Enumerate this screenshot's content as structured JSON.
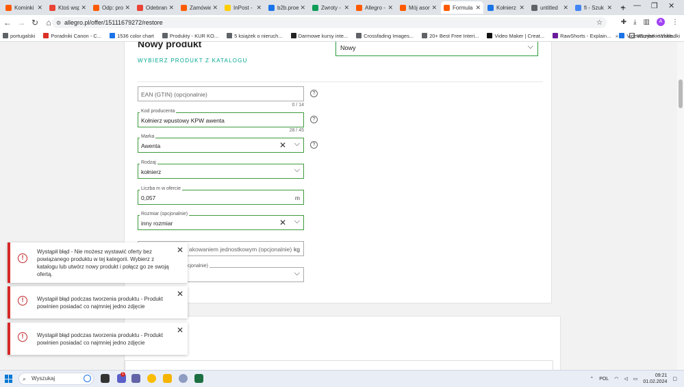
{
  "browser": {
    "tabs": [
      {
        "label": "Kominki",
        "color": "#ff5a00"
      },
      {
        "label": "Ktoś wsp",
        "color": "#ea4335"
      },
      {
        "label": "Odp: pro",
        "color": "#ff5a00"
      },
      {
        "label": "Odebrane",
        "color": "#ea4335"
      },
      {
        "label": "Zamówie",
        "color": "#ff5a00"
      },
      {
        "label": "InPost - ",
        "color": "#ffcd00"
      },
      {
        "label": "b2b.proe",
        "color": "#1a73e8"
      },
      {
        "label": "Zwroty - ",
        "color": "#0f9d58"
      },
      {
        "label": "Allegro - ",
        "color": "#ff5a00"
      },
      {
        "label": "Mój asor",
        "color": "#ff5a00"
      },
      {
        "label": "Formula",
        "color": "#ff5a00"
      },
      {
        "label": "Kołnierz",
        "color": "#1a73e8"
      },
      {
        "label": "untitled",
        "color": "#5f6368"
      },
      {
        "label": "fi - Szuk",
        "color": "#4285f4"
      }
    ],
    "active_tab_index": 10,
    "url": "allegro.pl/offer/15111679272/restore",
    "profile_initial": "A",
    "bookmarks": [
      {
        "label": "portugalski",
        "color": "#5f6368"
      },
      {
        "label": "Poradniki Canon - C...",
        "color": "#d93025"
      },
      {
        "label": "1536 color chart",
        "color": "#1a73e8"
      },
      {
        "label": "Produkty - KUR KO...",
        "color": "#5f6368"
      },
      {
        "label": "5 książek o nieruch...",
        "color": "#5f6368"
      },
      {
        "label": "Darmowe kursy inte...",
        "color": "#222222"
      },
      {
        "label": "Crossfading Images...",
        "color": "#5f6368"
      },
      {
        "label": "20+ Best Free Interi...",
        "color": "#5f6368"
      },
      {
        "label": "Video Maker | Creat...",
        "color": "#111111"
      },
      {
        "label": "RawShorts - Explain...",
        "color": "#6a1b9a"
      },
      {
        "label": "VideoScribe - White...",
        "color": "#1a73e8"
      }
    ],
    "all_bookmarks_label": "Wszystkie zakładki"
  },
  "form": {
    "title": "Nowy produkt",
    "catalog_link": "WYBIERZ PRODUKT Z KATALOGU",
    "condition_value": "Nowy",
    "ean": {
      "placeholder": "EAN (GTIN) (opcjonalnie)",
      "counter": "0 / 14"
    },
    "producer_code": {
      "label": "Kod producenta",
      "value": "Kołnierz wpustowy KPW awenta",
      "counter": "28 / 45"
    },
    "brand": {
      "label": "Marka",
      "value": "Awenta"
    },
    "type": {
      "label": "Rodzaj",
      "value": "kołnierz"
    },
    "meters": {
      "label": "Liczba m w ofercie",
      "value": "0,057",
      "unit": "m"
    },
    "size": {
      "label": "Rozmiar (opcjonalnie)",
      "value": "inny rozmiar"
    },
    "weight": {
      "placeholder_visible": "akowaniem jednostkowym (opcjonalnie)",
      "unit": "kg"
    },
    "extra_select": {
      "label_visible": "cjonalnie)"
    }
  },
  "toasts": [
    {
      "text": "Wystąpił błąd - Nie możesz wystawić oferty bez powiązanego produktu w tej kategorii. Wybierz z katalogu lub utwórz nowy produkt i połącz go ze swoją ofertą."
    },
    {
      "text": "Wystąpił błąd podczas tworzenia produktu - Produkt powinien posiadać co najmniej jedno zdjęcie"
    },
    {
      "text": "Wystąpił błąd podczas tworzenia produktu - Produkt powinien posiadać co najmniej jedno zdjęcie"
    }
  ],
  "taskbar": {
    "search_label": "Wyszukaj",
    "language": "POL",
    "time": "09:21",
    "date": "01.02.2024",
    "notification_count": "1"
  },
  "icons": {
    "back": "arrow-left-icon",
    "forward": "arrow-right-icon",
    "reload": "reload-icon",
    "home": "home-icon",
    "star": "star-icon",
    "close": "close-icon",
    "chevron": "chevron-down-icon",
    "help": "help-circle-icon",
    "error": "error-circle-icon"
  },
  "colors": {
    "accent_green": "#00a790",
    "valid_border": "#3d9b3d",
    "error_red": "#d62828"
  }
}
